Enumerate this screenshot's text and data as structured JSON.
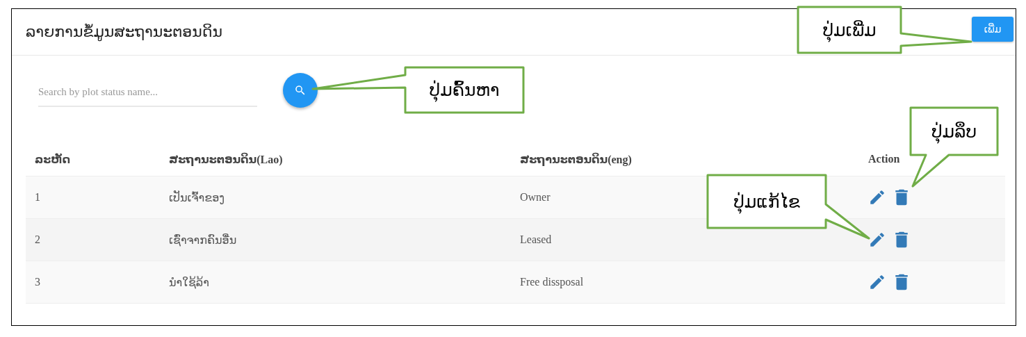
{
  "header": {
    "title": "ລາຍການຂໍ້ມູນສະຖານະຕອນດິນ",
    "add_button": "ເພີ່ມ"
  },
  "search": {
    "placeholder": "Search by plot status name..."
  },
  "table": {
    "columns": [
      "ລະຫັດ",
      "ສະຖານະຕອນດິນ(Lao)",
      "ສະຖານະຕອນດິນ(eng)",
      "Action"
    ],
    "rows": [
      {
        "cells": [
          "1",
          "ເປັນເຈົ້າຂອງ",
          "Owner"
        ]
      },
      {
        "cells": [
          "2",
          "ເຊົ່າຈາກຄົນອື່ນ",
          "Leased"
        ]
      },
      {
        "cells": [
          "3",
          "ນໍາໃຊ້ລ້າ",
          "Free dissposal"
        ]
      }
    ]
  },
  "callouts": [
    {
      "text": "ປຸ່ມເພີ່ມ"
    },
    {
      "text": "ປຸ່ມຄົ້ນຫາ"
    },
    {
      "text": "ປຸ່ມລຶບ"
    },
    {
      "text": "ປຸ່ມແກ້ໄຂ"
    }
  ]
}
